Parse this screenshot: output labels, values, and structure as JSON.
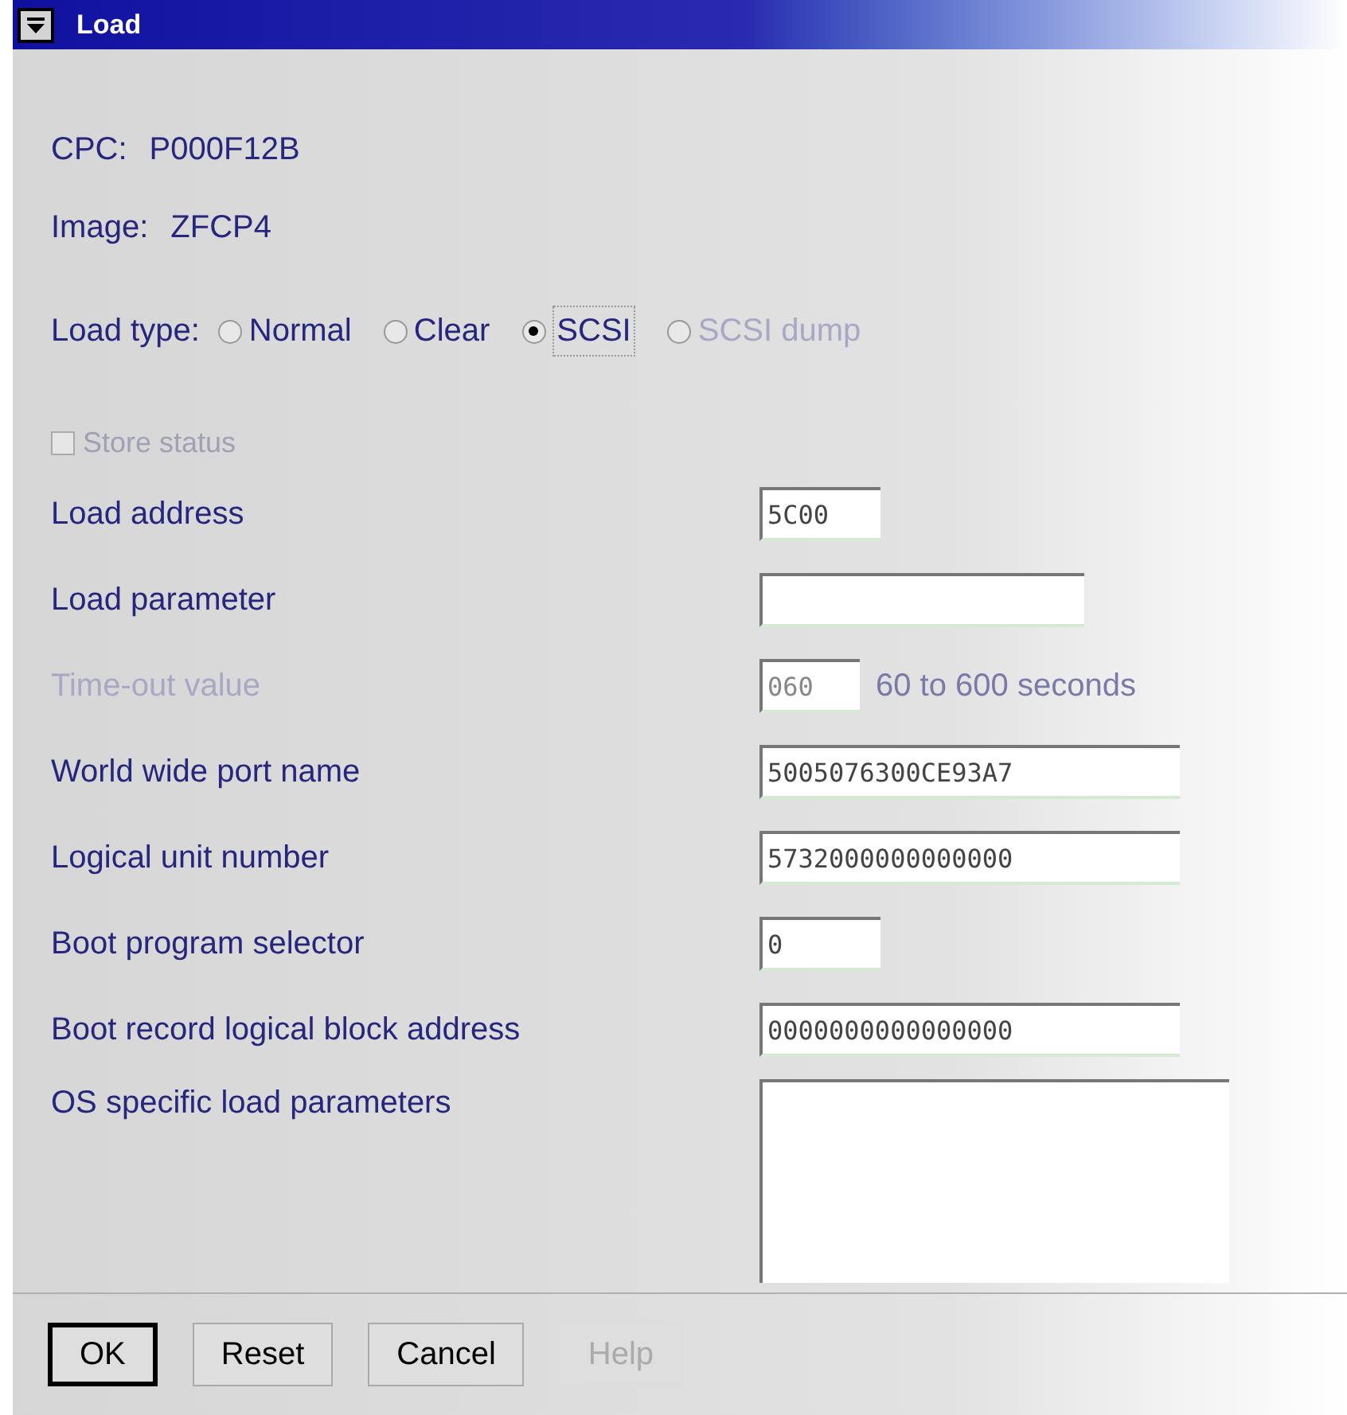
{
  "window": {
    "title": "Load"
  },
  "cpc": {
    "label": "CPC:",
    "value": "P000F12B"
  },
  "image": {
    "label": "Image:",
    "value": "ZFCP4"
  },
  "load_type": {
    "label": "Load type:",
    "options": [
      {
        "label": "Normal",
        "selected": false,
        "disabled": false
      },
      {
        "label": "Clear",
        "selected": false,
        "disabled": false
      },
      {
        "label": "SCSI",
        "selected": true,
        "disabled": false
      },
      {
        "label": "SCSI dump",
        "selected": false,
        "disabled": true
      }
    ]
  },
  "store_status": {
    "label": "Store status",
    "checked": false,
    "disabled": true
  },
  "fields": [
    {
      "kind": "text",
      "label": "Load address",
      "value": "5C00",
      "disabled": false
    },
    {
      "kind": "text",
      "label": "Load parameter",
      "disabled": false
    },
    {
      "kind": "text",
      "label": "Time-out value",
      "value": "060",
      "disabled": true,
      "note": "60 to 600 seconds"
    },
    {
      "kind": "text",
      "label": "World wide port name",
      "value": "5005076300CE93A7",
      "disabled": false
    },
    {
      "kind": "text",
      "label": "Logical unit number",
      "value": "5732000000000000",
      "disabled": false
    },
    {
      "kind": "text",
      "label": "Boot program selector",
      "value": "0",
      "disabled": false
    },
    {
      "kind": "text",
      "label": "Boot record logical block address",
      "value": "0000000000000000",
      "disabled": false
    },
    {
      "kind": "textarea",
      "label": "OS specific load parameters",
      "disabled": false
    }
  ],
  "buttons": [
    {
      "label": "OK",
      "default": true,
      "disabled": false
    },
    {
      "label": "Reset",
      "default": false,
      "disabled": false
    },
    {
      "label": "Cancel",
      "default": false,
      "disabled": false
    },
    {
      "label": "Help",
      "default": false,
      "disabled": true
    }
  ]
}
